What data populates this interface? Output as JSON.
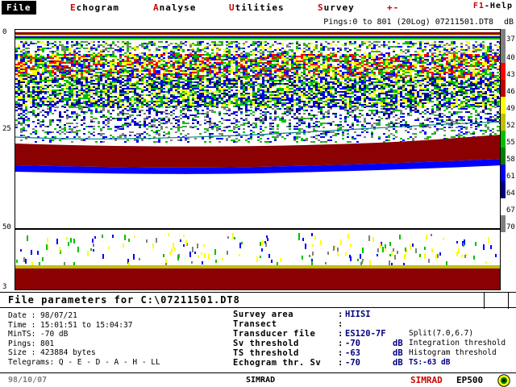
{
  "menu": {
    "items": [
      {
        "hot": "F",
        "rest": "ile",
        "active": true
      },
      {
        "hot": "E",
        "rest": "chogram",
        "active": false
      },
      {
        "hot": "A",
        "rest": "nalyse",
        "active": false
      },
      {
        "hot": "U",
        "rest": "tilities",
        "active": false
      },
      {
        "hot": "S",
        "rest": "urvey",
        "active": false
      },
      {
        "hot": "+-",
        "rest": "",
        "active": false
      }
    ],
    "help_key": "F1",
    "help_text": "-Help"
  },
  "echogram": {
    "ping_info": "Pings:0 to 801 (20Log) 07211501.DT8",
    "db_unit": "dB",
    "depth_labels": [
      "0",
      "25",
      "50"
    ],
    "bottom_label": "3"
  },
  "colors": {
    "scale": [
      "#808080",
      "#7f7f7f",
      "#ff0000",
      "#c00000",
      "#ffff00",
      "#c0c000",
      "#00c000",
      "#008000",
      "#0000ff",
      "#000080",
      "#ffffff",
      "#808080"
    ],
    "bottom_echo": "#8b0000",
    "accent_red": "#cc0000",
    "value_blue": "#000080"
  },
  "scale_labels": [
    "37",
    "40",
    "43",
    "46",
    "49",
    "52",
    "55",
    "58",
    "61",
    "64",
    "67",
    "70"
  ],
  "file_params": {
    "title": "File parameters for C:\\07211501.DT8"
  },
  "left_info": [
    "Date : 98/07/21",
    "Time : 15:01:51 to 15:04:37",
    "MinTS: -70 dB",
    "Pings: 801",
    "Size : 423884 bytes",
    "Telegrams: Q - E - D - A - H - LL"
  ],
  "right_info": [
    {
      "label": "Survey area",
      "value": "HIISI",
      "unit": "",
      "note": ""
    },
    {
      "label": "Transect",
      "value": "",
      "unit": "",
      "note": ""
    },
    {
      "label": "Transducer file",
      "value": "ES120-7F",
      "unit": "",
      "note": "Split(7.0,6.7)"
    },
    {
      "label": "Sv threshold",
      "value": "-70",
      "unit": "dB",
      "note": "Integration threshold"
    },
    {
      "label": "TS threshold",
      "value": "-63",
      "unit": "dB",
      "note": "Histogram threshold"
    },
    {
      "label": "Echogram thr. Sv",
      "value": "-70",
      "unit": "dB",
      "note": "TS:-63  dB"
    }
  ],
  "status": {
    "date": "98/10/07",
    "center": "SIMRAD",
    "brand": "SIMRAD",
    "model": "EP500"
  }
}
